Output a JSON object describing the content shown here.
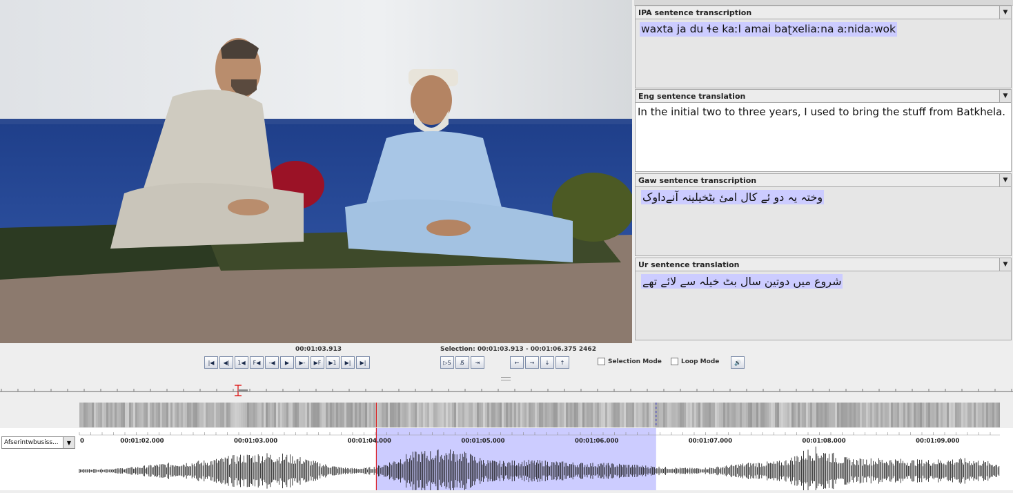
{
  "tiers": [
    {
      "title": "IPA sentence transcription",
      "text": "waxta ja du ɬe kaːl amai baʈxeliaːna aːnidaːwok"
    },
    {
      "title": "Eng sentence translation",
      "text": "In the initial two to three years, I used to bring the stuff from Batkhela."
    },
    {
      "title": "Gaw sentence transcription",
      "text": "وختہ یہ دو ئے کال امئ بٹخیلینہ آنےداوک"
    },
    {
      "title": "Ur sentence translation",
      "text": "شروع میں دوتین سال بٹ خیلہ سے لائے تھے"
    }
  ],
  "player": {
    "current_time": "00:01:03.913",
    "selection": "Selection: 00:01:03.913 - 00:01:06.375  2462",
    "selection_mode_label": "Selection Mode",
    "loop_mode_label": "Loop Mode"
  },
  "buttons": [
    {
      "name": "go-to-begin",
      "label": "|◀"
    },
    {
      "name": "previous-frame",
      "label": "◀|"
    },
    {
      "name": "step-back",
      "label": "1◀"
    },
    {
      "name": "previous-pixel",
      "label": "F◀"
    },
    {
      "name": "play-selection-back",
      "label": "-◀"
    },
    {
      "name": "play",
      "label": "▶"
    },
    {
      "name": "play-selection",
      "label": "▶-"
    },
    {
      "name": "next-pixel",
      "label": "▶F"
    },
    {
      "name": "step-forward",
      "label": "▶1"
    },
    {
      "name": "next-frame",
      "label": "▶|"
    },
    {
      "name": "go-to-end",
      "label": "▶|"
    }
  ],
  "selection_buttons": [
    {
      "name": "play-around-selection",
      "label": "▷S"
    },
    {
      "name": "clear-selection",
      "label": "S̸"
    },
    {
      "name": "selection-end",
      "label": "⇥"
    }
  ],
  "nav_buttons": [
    {
      "name": "arrow-left",
      "label": "←"
    },
    {
      "name": "arrow-right",
      "label": "→"
    },
    {
      "name": "arrow-down",
      "label": "↓"
    },
    {
      "name": "arrow-up",
      "label": "↑"
    }
  ],
  "timeline": {
    "tier_select": "Afserintwbusiss...",
    "zero_label": "0",
    "ticks": [
      "00:01:02.000",
      "00:01:03.000",
      "00:01:04.000",
      "00:01:05.000",
      "00:01:06.000",
      "00:01:07.000",
      "00:01:08.000",
      "00:01:09.000"
    ],
    "view_start_s": 61.3,
    "view_end_s": 69.4,
    "selection_start_s": 63.913,
    "selection_end_s": 66.375,
    "crosshair_s": 63.913
  },
  "colors": {
    "selection": "#ccccff",
    "crosshair": "#dd0000",
    "wave": "#111111"
  }
}
